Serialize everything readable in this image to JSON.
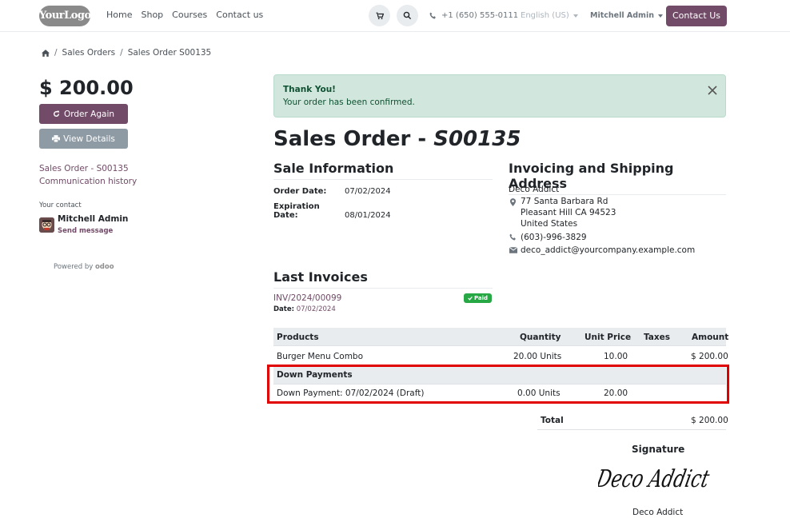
{
  "header": {
    "logo_text": "YourLogo",
    "nav": [
      "Home",
      "Shop",
      "Courses",
      "Contact us"
    ],
    "phone": "+1 (650) 555-0111",
    "language": "English (US)",
    "user": "Mitchell Admin",
    "contact_button": "Contact Us"
  },
  "breadcrumb": {
    "items": [
      "Sales Orders",
      "Sales Order S00135"
    ]
  },
  "sidebar": {
    "amount": "$ 200.00",
    "order_again": "Order Again",
    "view_details": "View Details",
    "link_sales_order": "Sales Order - S00135",
    "link_communication": "Communication history",
    "your_contact": "Your contact",
    "contact_name": "Mitchell Admin",
    "send_message": "Send message",
    "powered_by": "Powered by",
    "powered_brand": "odoo"
  },
  "alert": {
    "title": "Thank You!",
    "message": "Your order has been confirmed."
  },
  "order": {
    "title_prefix": "Sales Order - ",
    "title_number": "S00135",
    "sale_info_heading": "Sale Information",
    "order_date_label": "Order Date:",
    "order_date": "07/02/2024",
    "expiration_label": "Expiration Date:",
    "expiration_date": "08/01/2024",
    "address_heading": "Invoicing and Shipping Address",
    "customer": "Deco Addict",
    "address_lines": [
      "77 Santa Barbara Rd",
      "Pleasant Hill CA 94523",
      "United States"
    ],
    "phone": "(603)-996-3829",
    "email": "deco_addict@yourcompany.example.com"
  },
  "invoices": {
    "heading": "Last Invoices",
    "number": "INV/2024/00099",
    "date_label": "Date:",
    "date": "07/02/2024",
    "status": "Paid"
  },
  "table": {
    "headers": {
      "products": "Products",
      "quantity": "Quantity",
      "unit_price": "Unit Price",
      "taxes": "Taxes",
      "amount": "Amount"
    },
    "rows": [
      {
        "product": "Burger Menu Combo",
        "quantity": "20.00 Units",
        "unit_price": "10.00",
        "taxes": "",
        "amount": "$ 200.00"
      }
    ],
    "section_label": "Down Payments",
    "down_payment": {
      "product": "Down Payment: 07/02/2024 (Draft)",
      "quantity": "0.00 Units",
      "unit_price": "20.00",
      "taxes": "",
      "amount": ""
    },
    "total_label": "Total",
    "total_value": "$ 200.00"
  },
  "signature": {
    "label": "Signature",
    "handwritten": "Deco Addict",
    "name": "Deco Addict"
  },
  "colors": {
    "brand": "#714b67",
    "success_bg": "#d1e7dd",
    "success_text": "#0f5132",
    "highlight": "#e00000"
  }
}
